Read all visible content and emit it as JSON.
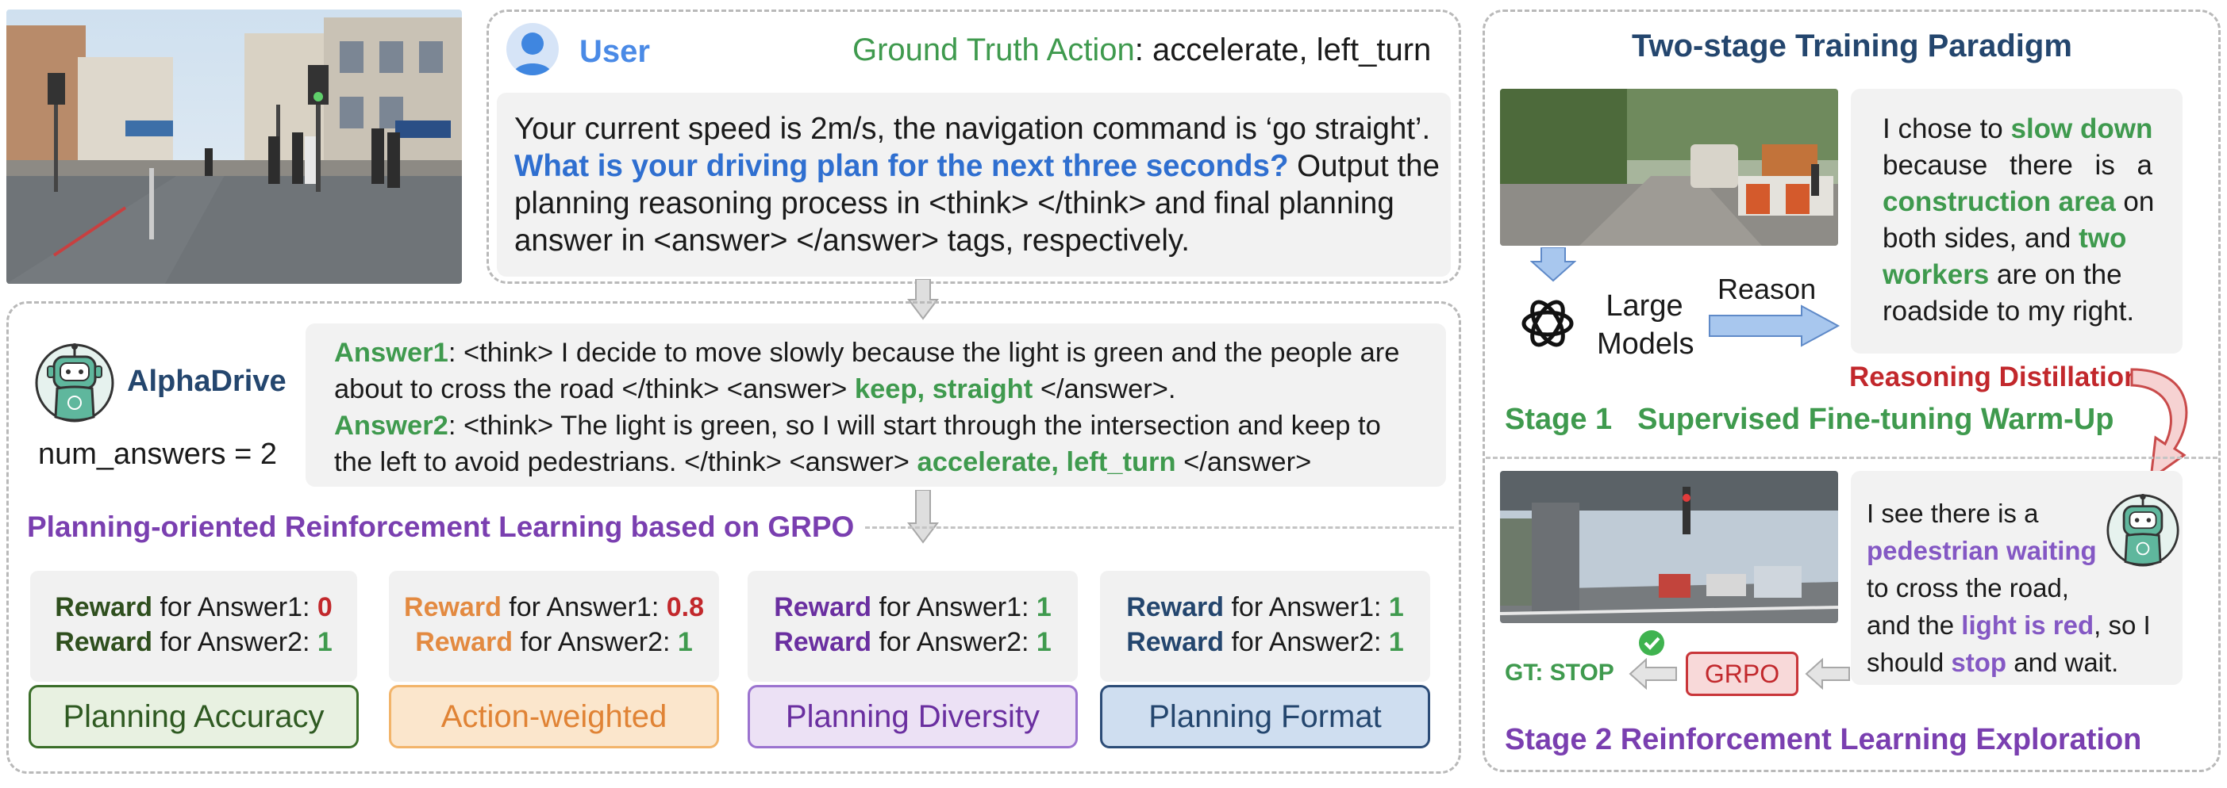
{
  "user_panel": {
    "user_label": "User",
    "gt_label": "Ground Truth Action",
    "gt_value": ": accelerate, left_turn",
    "prompt_line1": "Your current speed is 2m/s, the navigation command is ‘go straight’.",
    "prompt_question": "What is your driving plan for the next three seconds?",
    "prompt_line2_tail": " Output the",
    "prompt_line3": "planning reasoning process in <think> </think> and final planning",
    "prompt_line4": "answer in <answer> </answer> tags, respectively."
  },
  "model_panel": {
    "name": "AlphaDrive",
    "num_answers": "num_answers = 2",
    "answer1_label": "Answer1",
    "answer1_line1": ": <think> I decide to move slowly because the light is green and the people are",
    "answer1_line2_pre": "about to cross the road </think> <answer> ",
    "answer1_action": "keep, straight",
    "answer1_line2_post": " </answer>.",
    "answer2_label": "Answer2",
    "answer2_line1": ": <think> The light is green, so I will start through the intersection and keep to",
    "answer2_line2_pre": "the left to avoid pedestrians. </think> <answer> ",
    "answer2_action": "accelerate, left_turn",
    "answer2_line2_post": " </answer>",
    "rl_title": "Planning-oriented Reinforcement Learning based on GRPO"
  },
  "rewards": [
    {
      "reward_word": "Reward",
      "a1": " for Answer1: ",
      "v1": "0",
      "a2": " for Answer2: ",
      "v2": "1",
      "category": "Planning Accuracy"
    },
    {
      "reward_word": "Reward",
      "a1": " for Answer1: ",
      "v1": "0.8",
      "a2": " for Answer2: ",
      "v2": "1",
      "category": "Action-weighted"
    },
    {
      "reward_word": "Reward",
      "a1": " for Answer1: ",
      "v1": "1",
      "a2": " for Answer2: ",
      "v2": "1",
      "category": "Planning Diversity"
    },
    {
      "reward_word": "Reward",
      "a1": " for Answer1: ",
      "v1": "1",
      "a2": " for Answer2: ",
      "v2": "1",
      "category": "Planning Format"
    }
  ],
  "training": {
    "title": "Two-stage Training Paradigm",
    "large_models_1": "Large",
    "large_models_2": "Models",
    "reason": "Reason",
    "s1_l1_pre": "I chose to ",
    "s1_slow_down": "slow down",
    "s1_l2": "because there is a",
    "s1_construction": "construction area",
    "s1_on": " on",
    "s1_l4_pre": "both sides, and ",
    "s1_two": "two",
    "s1_workers": "workers",
    "s1_l5_post": " are on the",
    "s1_l6": "roadside to my right.",
    "distill": "Reasoning Distillation",
    "stage1_label": "Stage 1",
    "stage1_name": "Supervised Fine-tuning Warm-Up",
    "s2_l1": "I see there is  a",
    "s2_pedestrian": "pedestrian waiting",
    "s2_l3": "to cross the road,",
    "s2_l4_pre": "and the ",
    "s2_red": "light is red",
    "s2_l4_post": ", so I",
    "s2_l5_pre": "should ",
    "s2_stop": "stop",
    "s2_l5_post": " and wait.",
    "gt_stop": "GT: STOP",
    "grpo": "GRPO",
    "stage2_label": "Stage 2",
    "stage2_name": "Reinforcement Learning Exploration"
  },
  "colors": {
    "accent_green": "#3f9a4e",
    "accent_blue": "#2f6fd0",
    "accent_purple": "#8458c4",
    "accent_navy": "#24466e",
    "accent_red": "#c2282c",
    "accent_orange": "#e38a41"
  }
}
